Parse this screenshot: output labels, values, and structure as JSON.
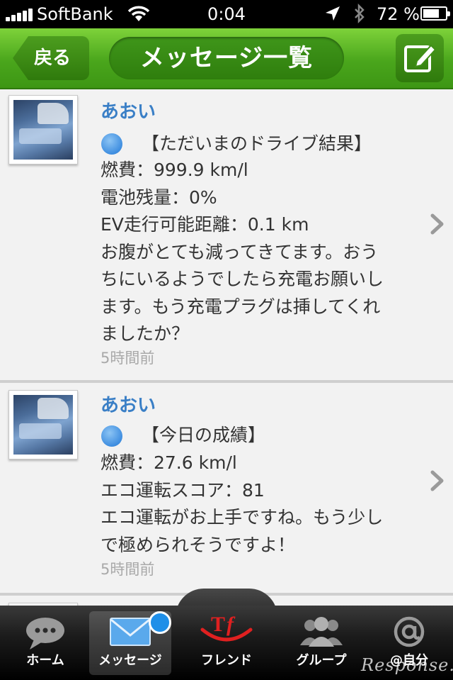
{
  "status_bar": {
    "carrier": "SoftBank",
    "time": "0:04",
    "battery_percent": "72 %",
    "battery_level": 0.72
  },
  "nav": {
    "back_label": "戻る",
    "title": "メッセージ一覧",
    "compose_icon": "compose-icon"
  },
  "messages": [
    {
      "sender": "あおい",
      "heading": "【ただいまのドライブ結果】",
      "lines": [
        "燃費：999.9 km/l",
        "電池残量：0%",
        "EV走行可能距離：0.1 km",
        "お腹がとても減ってきてます。おう",
        "ちにいるようでしたら充電お願いし",
        "ます。もう充電プラグは挿してくれ",
        "ましたか？"
      ],
      "timestamp": "5時間前"
    },
    {
      "sender": "あおい",
      "heading": "【今日の成績】",
      "lines": [
        "燃費：27.6 km/l",
        "エコ運転スコア：81",
        "エコ運転がお上手ですね。もう少し",
        "で極められそうですよ！"
      ],
      "timestamp": "5時間前"
    }
  ],
  "tabs": [
    {
      "label": "ホーム",
      "icon": "chat-bubble-icon"
    },
    {
      "label": "メッセージ",
      "icon": "envelope-icon"
    },
    {
      "label": "フレンド",
      "icon": "tf-logo-icon"
    },
    {
      "label": "グループ",
      "icon": "group-icon"
    },
    {
      "label": "@自分",
      "icon": "at-icon"
    }
  ],
  "watermark": "Response.",
  "colors": {
    "nav_green": "#4aa61c",
    "sender_blue": "#3a7fc6",
    "badge_blue": "#1f8fe8",
    "logo_red": "#e02020"
  }
}
